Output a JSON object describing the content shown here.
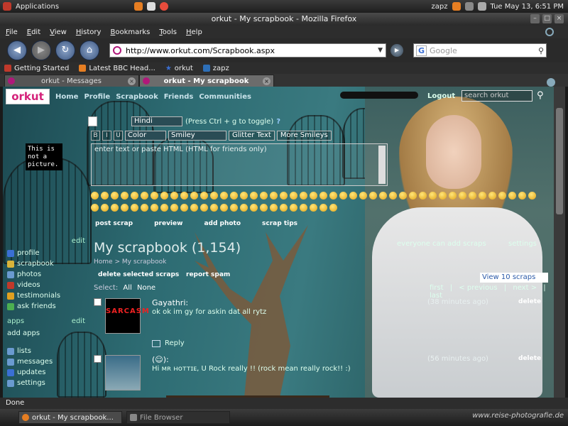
{
  "panel": {
    "apps_label": "Applications",
    "user": "zapz",
    "clock": "Tue May 13,  6:51 PM"
  },
  "window": {
    "title": "orkut - My scrapbook - Mozilla Firefox"
  },
  "menu": [
    "File",
    "Edit",
    "View",
    "History",
    "Bookmarks",
    "Tools",
    "Help"
  ],
  "nav": {
    "url": "http://www.orkut.com/Scrapbook.aspx",
    "search_placeholder": "Google",
    "search_engine": "G"
  },
  "bookmarks": [
    {
      "label": "Getting Started",
      "color": "#c0392b"
    },
    {
      "label": "Latest BBC Head...",
      "color": "#e67e22"
    },
    {
      "label": "orkut",
      "color": "#3a6fd4"
    },
    {
      "label": "zapz",
      "color": "#2d6fb8"
    }
  ],
  "tabs": [
    {
      "label": "orkut - Messages",
      "active": false
    },
    {
      "label": "orkut - My scrapbook",
      "active": true
    }
  ],
  "orkut": {
    "logo": "orkut",
    "nav": [
      "Home",
      "Profile",
      "Scrapbook",
      "Friends",
      "Communities"
    ],
    "logout": "Logout",
    "search_placeholder": "search orkut"
  },
  "editor": {
    "language": "Hindi",
    "hint": "(Press Ctrl + g to toggle)",
    "help": "?",
    "color_label": "Color",
    "smiley_label": "Smiley",
    "glitter": "Glitter Text",
    "more_smileys": "More Smileys",
    "placeholder": "enter text or paste HTML (HTML for friends only)",
    "fmt": [
      "B",
      "I",
      "U"
    ]
  },
  "actions": [
    "post scrap",
    "preview",
    "add photo",
    "scrap tips"
  ],
  "sidebar": {
    "not_a_picture": "This is not a picture.",
    "edit": "edit",
    "items": [
      {
        "label": "profile",
        "color": "#3a6fd4"
      },
      {
        "label": "scrapbook",
        "color": "#d9b33a"
      },
      {
        "label": "photos",
        "color": "#6a9ad0"
      },
      {
        "label": "videos",
        "color": "#c0392b"
      },
      {
        "label": "testimonials",
        "color": "#e0a020"
      },
      {
        "label": "ask friends",
        "color": "#4caf50"
      }
    ],
    "apps_head": "apps",
    "apps_edit": "edit",
    "add_apps": "add apps",
    "items2": [
      {
        "label": "lists",
        "color": "#6a9ad0"
      },
      {
        "label": "messages",
        "color": "#6a9ad0"
      },
      {
        "label": "updates",
        "color": "#3a6fd4"
      },
      {
        "label": "settings",
        "color": "#6a9ad0"
      }
    ]
  },
  "scrapbook": {
    "title": "My scrapbook (1,154)",
    "breadcrumb_home": "Home",
    "breadcrumb_sep": ">",
    "breadcrumb_current": "My scrapbook",
    "everyone": "everyone can add scraps",
    "settings": "settings",
    "delete_selected": "delete selected scraps",
    "report_spam": "report spam",
    "view": "View 10 scraps",
    "select_label": "Select:",
    "select_all": "All",
    "select_none": "None",
    "pager": [
      "first",
      "|",
      "< previous",
      "|",
      "next >",
      "|",
      "last"
    ],
    "scraps": [
      {
        "name": "Gayathri:",
        "message": "ok ok im gy for askin dat all rytz",
        "time": "(38 minutes ago)",
        "delete": "delete",
        "reply": "Reply",
        "avatar_text": "SARCASM"
      },
      {
        "name": "(☺):",
        "message": "Hi ᴍʀ ʜᴏᴛᴛɪᴇ, U Rock really !! (rock mean really rock!! :)",
        "time": "(56 minutes ago)",
        "delete": "delete"
      }
    ]
  },
  "status": "Done",
  "taskbar": [
    {
      "label": "orkut - My scrapbook...",
      "active": true
    },
    {
      "label": "File Browser",
      "active": false
    }
  ],
  "watermark": "www.reise-photografie.de"
}
